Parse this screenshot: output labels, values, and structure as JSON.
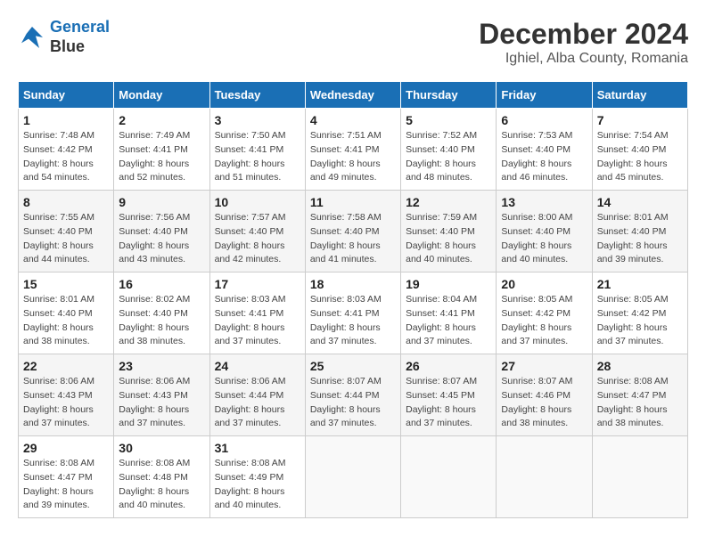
{
  "header": {
    "logo_line1": "General",
    "logo_line2": "Blue",
    "title": "December 2024",
    "subtitle": "Ighiel, Alba County, Romania"
  },
  "calendar": {
    "days_of_week": [
      "Sunday",
      "Monday",
      "Tuesday",
      "Wednesday",
      "Thursday",
      "Friday",
      "Saturday"
    ],
    "weeks": [
      [
        {
          "day": "1",
          "info": "Sunrise: 7:48 AM\nSunset: 4:42 PM\nDaylight: 8 hours\nand 54 minutes."
        },
        {
          "day": "2",
          "info": "Sunrise: 7:49 AM\nSunset: 4:41 PM\nDaylight: 8 hours\nand 52 minutes."
        },
        {
          "day": "3",
          "info": "Sunrise: 7:50 AM\nSunset: 4:41 PM\nDaylight: 8 hours\nand 51 minutes."
        },
        {
          "day": "4",
          "info": "Sunrise: 7:51 AM\nSunset: 4:41 PM\nDaylight: 8 hours\nand 49 minutes."
        },
        {
          "day": "5",
          "info": "Sunrise: 7:52 AM\nSunset: 4:40 PM\nDaylight: 8 hours\nand 48 minutes."
        },
        {
          "day": "6",
          "info": "Sunrise: 7:53 AM\nSunset: 4:40 PM\nDaylight: 8 hours\nand 46 minutes."
        },
        {
          "day": "7",
          "info": "Sunrise: 7:54 AM\nSunset: 4:40 PM\nDaylight: 8 hours\nand 45 minutes."
        }
      ],
      [
        {
          "day": "8",
          "info": "Sunrise: 7:55 AM\nSunset: 4:40 PM\nDaylight: 8 hours\nand 44 minutes."
        },
        {
          "day": "9",
          "info": "Sunrise: 7:56 AM\nSunset: 4:40 PM\nDaylight: 8 hours\nand 43 minutes."
        },
        {
          "day": "10",
          "info": "Sunrise: 7:57 AM\nSunset: 4:40 PM\nDaylight: 8 hours\nand 42 minutes."
        },
        {
          "day": "11",
          "info": "Sunrise: 7:58 AM\nSunset: 4:40 PM\nDaylight: 8 hours\nand 41 minutes."
        },
        {
          "day": "12",
          "info": "Sunrise: 7:59 AM\nSunset: 4:40 PM\nDaylight: 8 hours\nand 40 minutes."
        },
        {
          "day": "13",
          "info": "Sunrise: 8:00 AM\nSunset: 4:40 PM\nDaylight: 8 hours\nand 40 minutes."
        },
        {
          "day": "14",
          "info": "Sunrise: 8:01 AM\nSunset: 4:40 PM\nDaylight: 8 hours\nand 39 minutes."
        }
      ],
      [
        {
          "day": "15",
          "info": "Sunrise: 8:01 AM\nSunset: 4:40 PM\nDaylight: 8 hours\nand 38 minutes."
        },
        {
          "day": "16",
          "info": "Sunrise: 8:02 AM\nSunset: 4:40 PM\nDaylight: 8 hours\nand 38 minutes."
        },
        {
          "day": "17",
          "info": "Sunrise: 8:03 AM\nSunset: 4:41 PM\nDaylight: 8 hours\nand 37 minutes."
        },
        {
          "day": "18",
          "info": "Sunrise: 8:03 AM\nSunset: 4:41 PM\nDaylight: 8 hours\nand 37 minutes."
        },
        {
          "day": "19",
          "info": "Sunrise: 8:04 AM\nSunset: 4:41 PM\nDaylight: 8 hours\nand 37 minutes."
        },
        {
          "day": "20",
          "info": "Sunrise: 8:05 AM\nSunset: 4:42 PM\nDaylight: 8 hours\nand 37 minutes."
        },
        {
          "day": "21",
          "info": "Sunrise: 8:05 AM\nSunset: 4:42 PM\nDaylight: 8 hours\nand 37 minutes."
        }
      ],
      [
        {
          "day": "22",
          "info": "Sunrise: 8:06 AM\nSunset: 4:43 PM\nDaylight: 8 hours\nand 37 minutes."
        },
        {
          "day": "23",
          "info": "Sunrise: 8:06 AM\nSunset: 4:43 PM\nDaylight: 8 hours\nand 37 minutes."
        },
        {
          "day": "24",
          "info": "Sunrise: 8:06 AM\nSunset: 4:44 PM\nDaylight: 8 hours\nand 37 minutes."
        },
        {
          "day": "25",
          "info": "Sunrise: 8:07 AM\nSunset: 4:44 PM\nDaylight: 8 hours\nand 37 minutes."
        },
        {
          "day": "26",
          "info": "Sunrise: 8:07 AM\nSunset: 4:45 PM\nDaylight: 8 hours\nand 37 minutes."
        },
        {
          "day": "27",
          "info": "Sunrise: 8:07 AM\nSunset: 4:46 PM\nDaylight: 8 hours\nand 38 minutes."
        },
        {
          "day": "28",
          "info": "Sunrise: 8:08 AM\nSunset: 4:47 PM\nDaylight: 8 hours\nand 38 minutes."
        }
      ],
      [
        {
          "day": "29",
          "info": "Sunrise: 8:08 AM\nSunset: 4:47 PM\nDaylight: 8 hours\nand 39 minutes."
        },
        {
          "day": "30",
          "info": "Sunrise: 8:08 AM\nSunset: 4:48 PM\nDaylight: 8 hours\nand 40 minutes."
        },
        {
          "day": "31",
          "info": "Sunrise: 8:08 AM\nSunset: 4:49 PM\nDaylight: 8 hours\nand 40 minutes."
        },
        {
          "day": "",
          "info": ""
        },
        {
          "day": "",
          "info": ""
        },
        {
          "day": "",
          "info": ""
        },
        {
          "day": "",
          "info": ""
        }
      ]
    ]
  }
}
